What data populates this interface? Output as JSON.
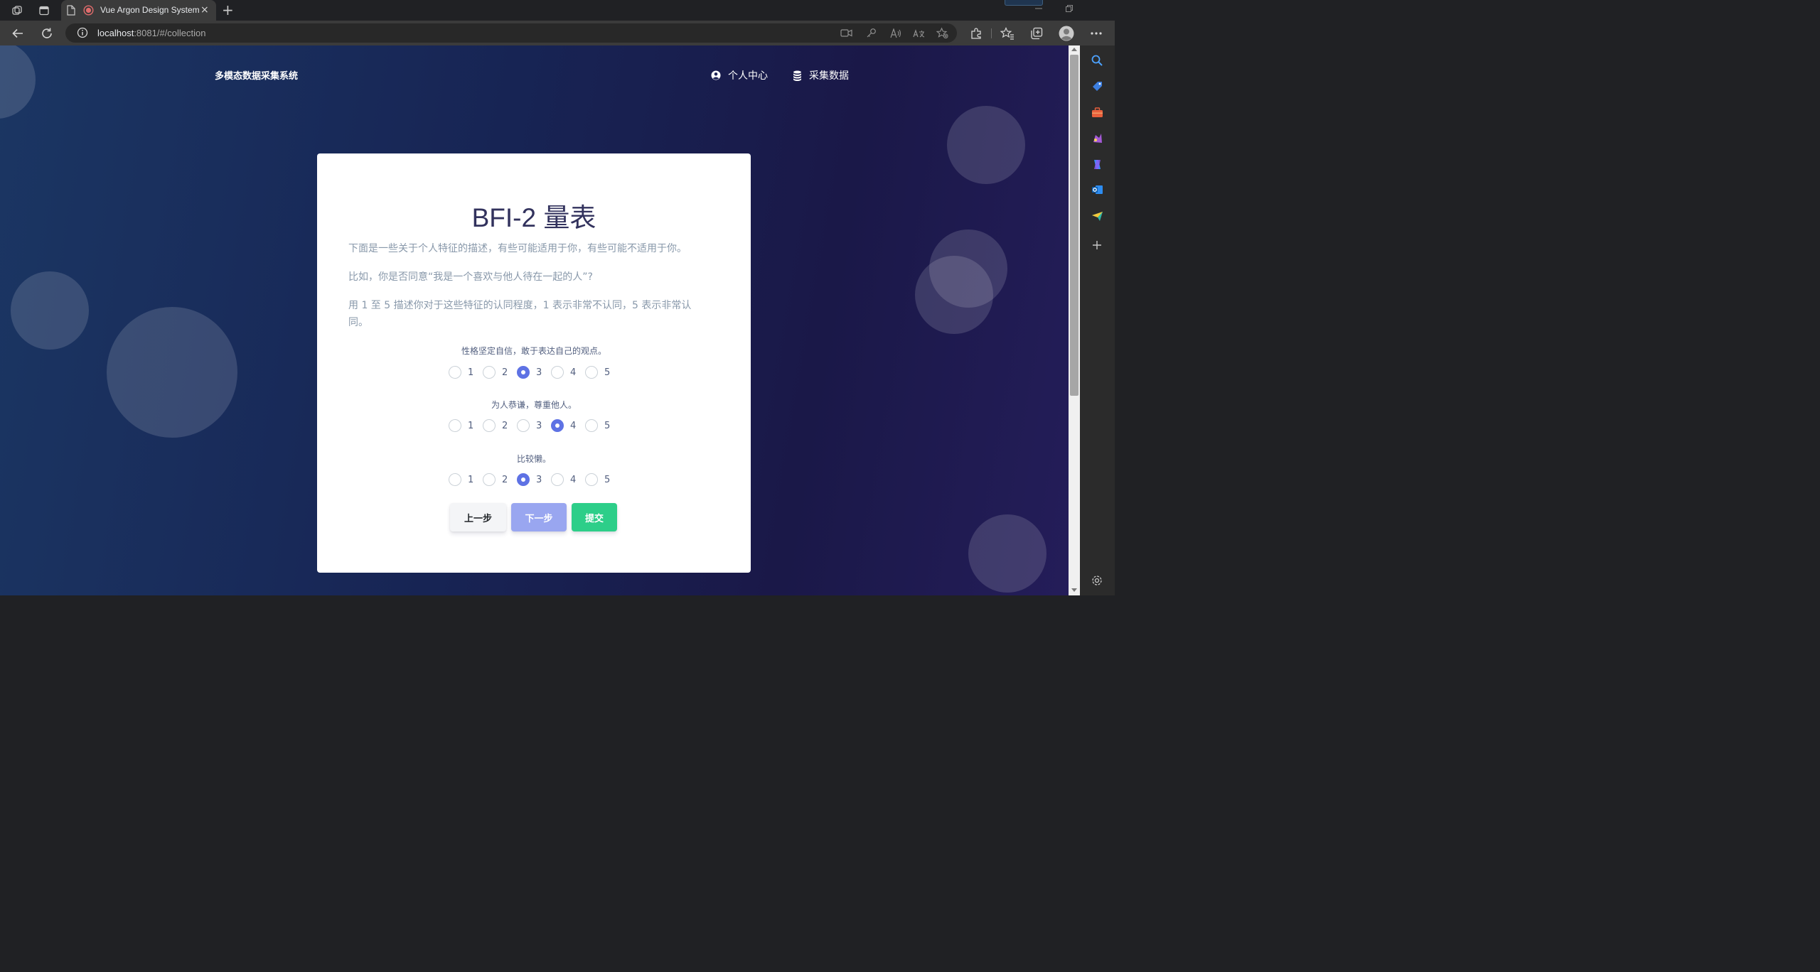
{
  "browser": {
    "tab_title": "Vue Argon Design System",
    "url_host": "localhost",
    "url_path": ":8081/#/collection",
    "new_tab_glyph": "+",
    "close_glyph": "×"
  },
  "navbar": {
    "brand": "多模态数据采集系统",
    "links": [
      {
        "label": "个人中心",
        "icon": "user-circle-icon"
      },
      {
        "label": "采集数据",
        "icon": "database-icon"
      }
    ]
  },
  "card": {
    "title": "BFI-2 量表",
    "paragraphs": [
      "下面是一些关于个人特征的描述，有些可能适用于你，有些可能不适用于你。",
      "比如，你是否同意“我是一个喜欢与他人待在一起的人”?",
      "用 1 至 5 描述你对于这些特征的认同程度，1 表示非常不认同，5 表示非常认同。"
    ],
    "scale_options": [
      "1",
      "2",
      "3",
      "4",
      "5"
    ],
    "questions": [
      {
        "text": "性格坚定自信，敢于表达自己的观点。",
        "selected": "3"
      },
      {
        "text": "为人恭谦，尊重他人。",
        "selected": "4"
      },
      {
        "text": "比较懒。",
        "selected": "3"
      }
    ],
    "buttons": {
      "prev": "上一步",
      "next": "下一步",
      "submit": "提交"
    }
  },
  "colors": {
    "primary": "#5e72e4",
    "success": "#2dce89",
    "heading": "#32325d",
    "muted": "#8898aa"
  }
}
